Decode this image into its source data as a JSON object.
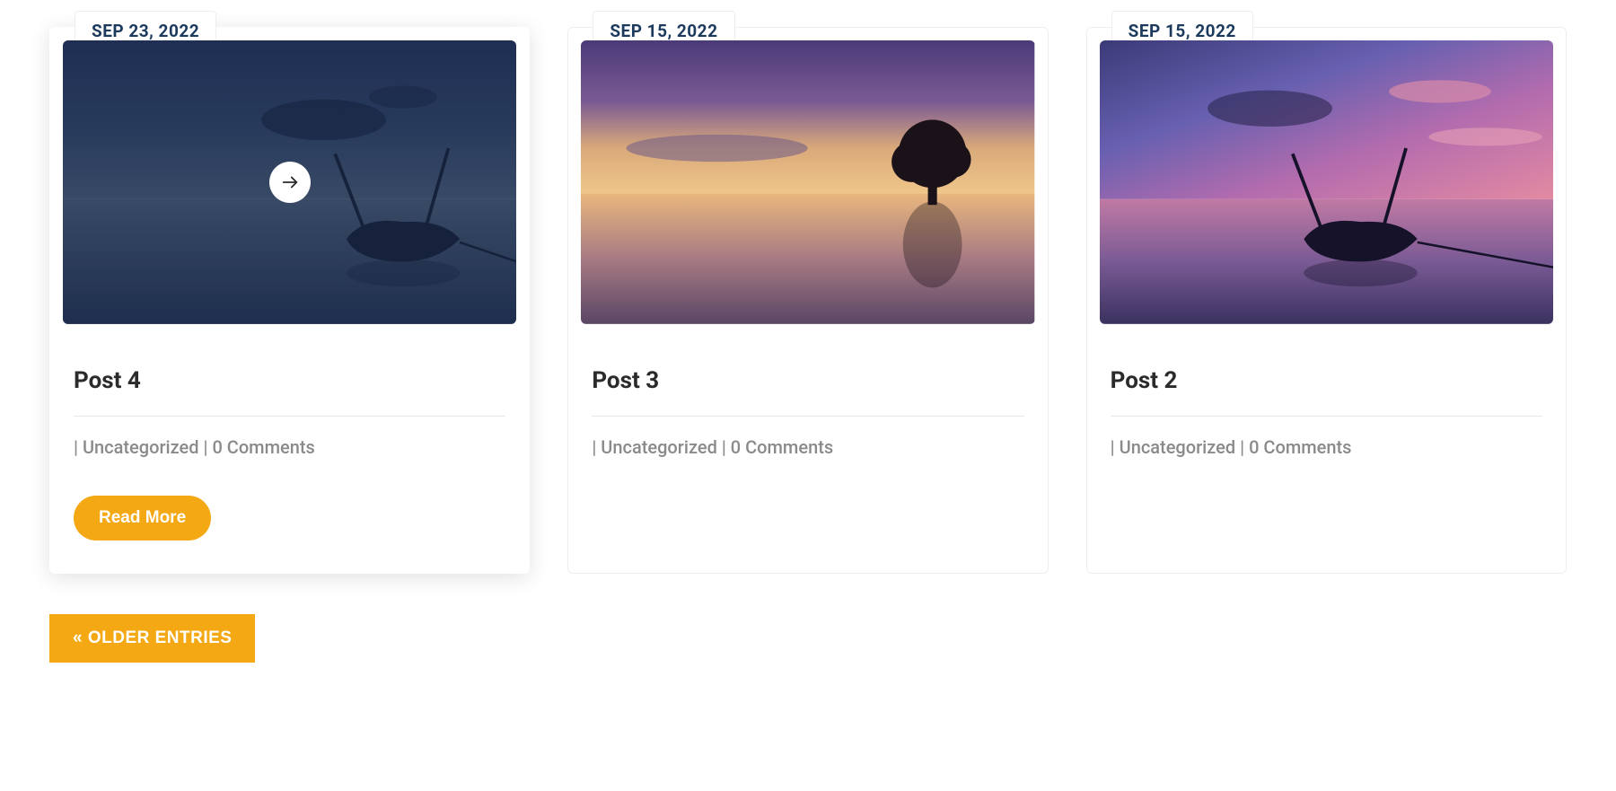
{
  "posts": [
    {
      "date": "SEP 23, 2022",
      "title": "Post 4",
      "meta_sep1": " | ",
      "category": "Uncategorized",
      "meta_sep2": " | ",
      "comments": "0 Comments",
      "hovered": true
    },
    {
      "date": "SEP 15, 2022",
      "title": "Post 3",
      "meta_sep1": " | ",
      "category": "Uncategorized",
      "meta_sep2": " | ",
      "comments": "0 Comments",
      "hovered": false
    },
    {
      "date": "SEP 15, 2022",
      "title": "Post 2",
      "meta_sep1": " | ",
      "category": "Uncategorized",
      "meta_sep2": " | ",
      "comments": "0 Comments",
      "hovered": false
    }
  ],
  "read_more_label": "Read More",
  "older_entries_label": "« OLDER ENTRIES",
  "colors": {
    "accent": "#f4a814",
    "date_text": "#1b3a5c",
    "meta_text": "#8a8a8a",
    "title_text": "#2b2b2b"
  }
}
